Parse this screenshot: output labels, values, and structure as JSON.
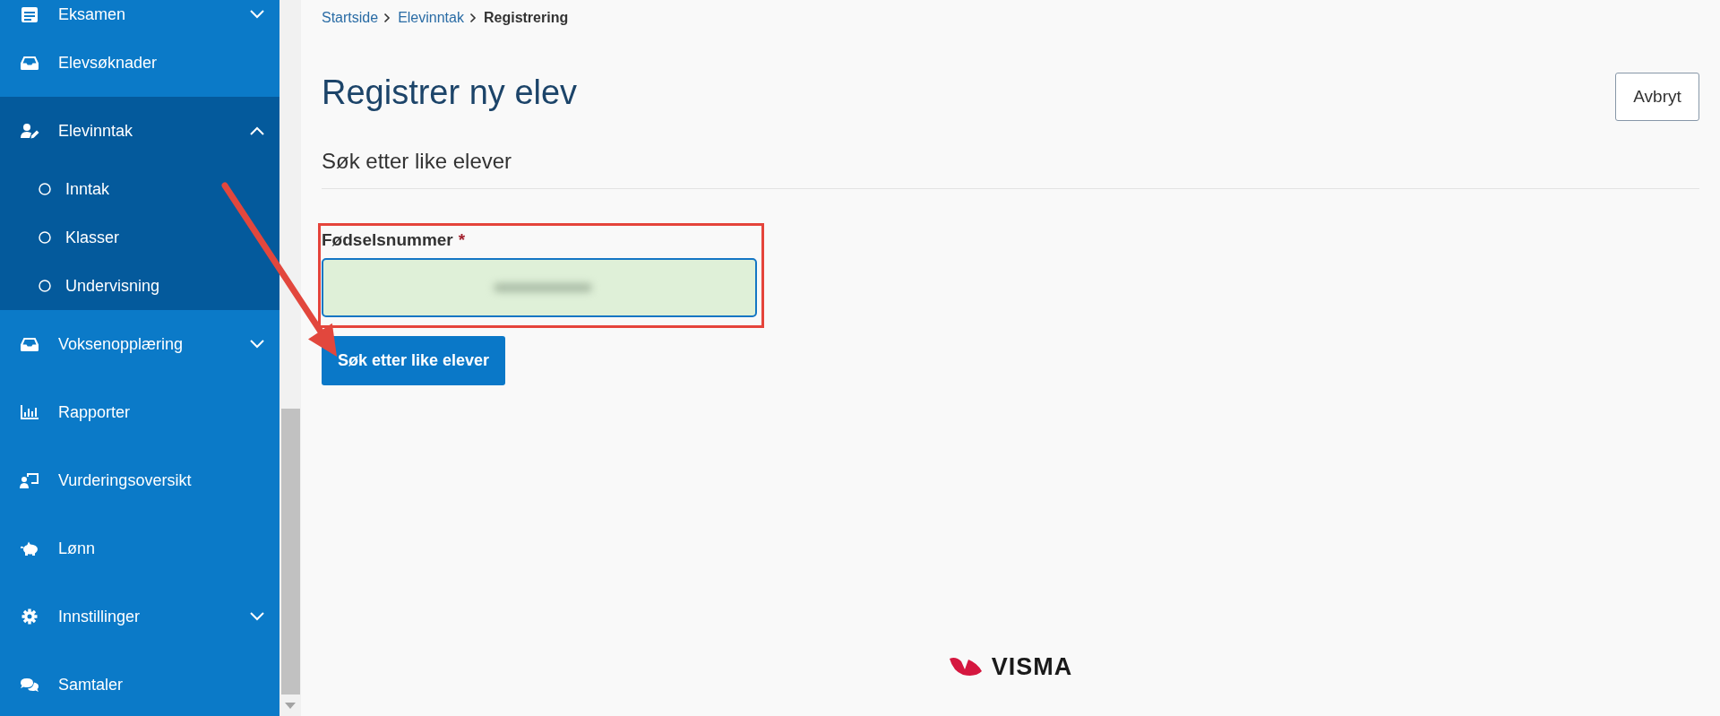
{
  "sidebar": {
    "items": [
      {
        "label": "Eksamen",
        "kind": "group",
        "expanded": false
      },
      {
        "label": "Elevsøknader",
        "kind": "link"
      },
      {
        "label": "Elevinntak",
        "kind": "group",
        "expanded": true,
        "children": [
          {
            "label": "Inntak",
            "selected": false
          },
          {
            "label": "Klasser",
            "selected": false
          },
          {
            "label": "Undervisning",
            "selected": false
          }
        ]
      },
      {
        "label": "Voksenopplæring",
        "kind": "group",
        "expanded": false
      },
      {
        "label": "Rapporter",
        "kind": "link"
      },
      {
        "label": "Vurderingsoversikt",
        "kind": "link"
      },
      {
        "label": "Lønn",
        "kind": "link"
      },
      {
        "label": "Innstillinger",
        "kind": "group",
        "expanded": false
      },
      {
        "label": "Samtaler",
        "kind": "link"
      }
    ]
  },
  "breadcrumb": [
    {
      "label": "Startside",
      "kind": "link"
    },
    {
      "label": "Elevinntak",
      "kind": "link"
    },
    {
      "label": "Registrering",
      "kind": "current"
    }
  ],
  "page": {
    "title": "Registrer ny elev",
    "cancel_button": "Avbryt",
    "section_title": "Søk etter like elever"
  },
  "form": {
    "field": {
      "label": "Fødselsnummer",
      "required_mark": "*",
      "valid": true,
      "focused": true,
      "redacted": true,
      "highlighted": true
    },
    "submit_button": "Søk etter like elever"
  },
  "footer": {
    "logo_text": "VISMA"
  }
}
